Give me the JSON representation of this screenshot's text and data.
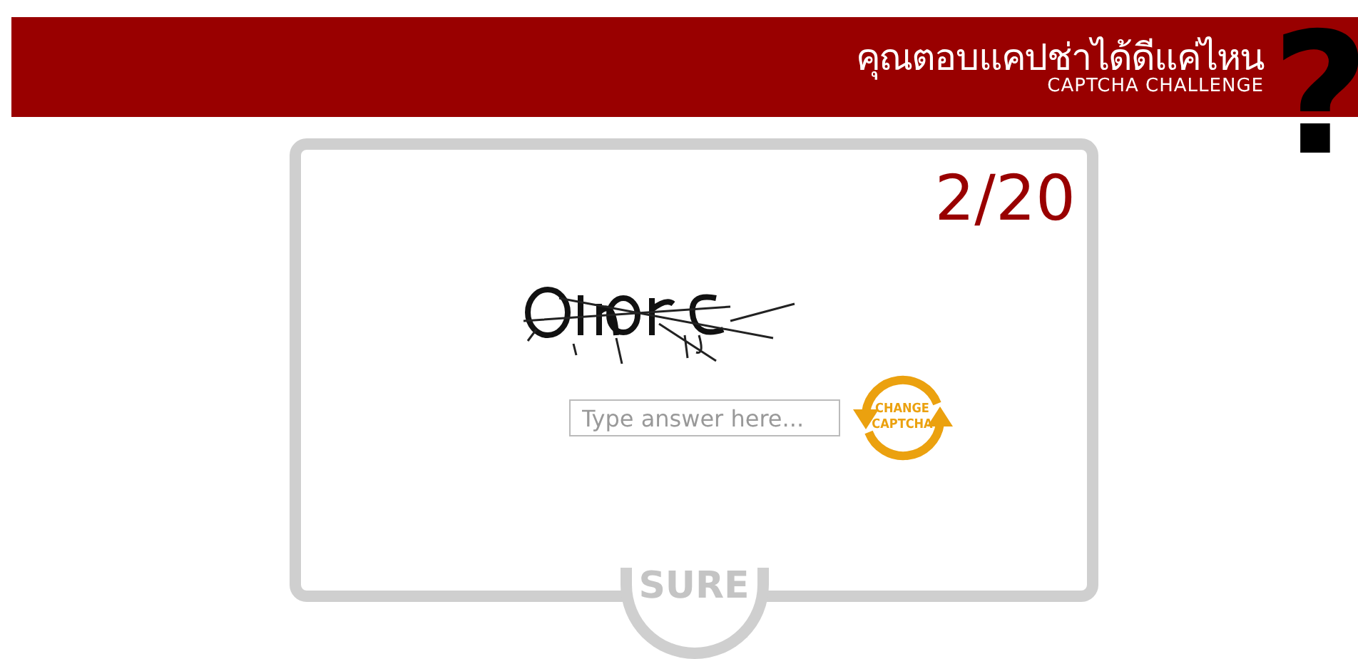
{
  "header": {
    "title": "คุณตอบแคปช่าได้ดีแค่ไหน",
    "subtitle": "CAPTCHA CHALLENGE",
    "mark": "?"
  },
  "card": {
    "counter": "2/20",
    "answer": {
      "placeholder": "Type answer here..."
    },
    "change_button": {
      "lines": [
        "CHANGE",
        "CAPTCHA"
      ]
    },
    "submit_button": {
      "label": "SURE"
    }
  }
}
